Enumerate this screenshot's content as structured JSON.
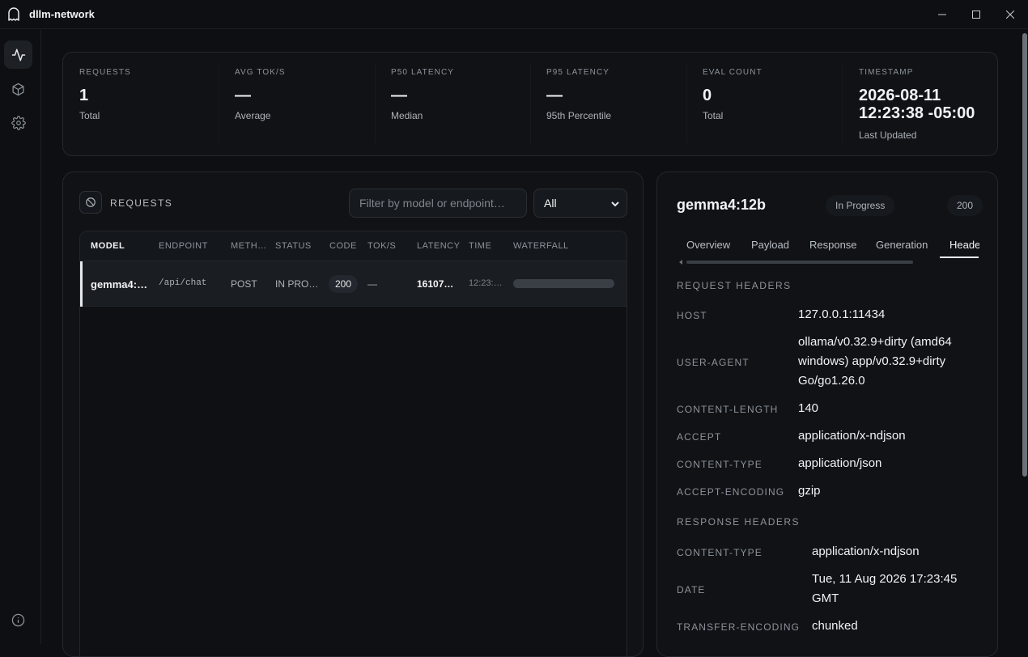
{
  "app": {
    "title": "dllm-network"
  },
  "stats": [
    {
      "label": "REQUESTS",
      "value": "1",
      "sub": "Total"
    },
    {
      "label": "AVG TOK/S",
      "value": "—",
      "sub": "Average"
    },
    {
      "label": "P50 LATENCY",
      "value": "—",
      "sub": "Median"
    },
    {
      "label": "P95 LATENCY",
      "value": "—",
      "sub": "95th Percentile"
    },
    {
      "label": "EVAL COUNT",
      "value": "0",
      "sub": "Total"
    },
    {
      "label": "TIMESTAMP",
      "value_line1": "2026-08-11",
      "value_line2": "12:23:38 -05:00",
      "sub": "Last Updated"
    }
  ],
  "requests": {
    "title": "REQUESTS",
    "filter_placeholder": "Filter by model or endpoint…",
    "select_value": "All",
    "columns": [
      "MODEL",
      "ENDPOINT",
      "METH…",
      "STATUS",
      "CODE",
      "TOK/S",
      "LATENCY",
      "TIME",
      "WATERFALL"
    ],
    "rows": [
      {
        "model": "gemma4:…",
        "endpoint": "/api/chat",
        "method": "POST",
        "status": "IN PRO…",
        "code": "200",
        "toks": "—",
        "latency": "16107…",
        "time": "12:23:…",
        "waterfall_fraction": 0.0
      }
    ]
  },
  "detail": {
    "model": "gemma4:12b",
    "status": "In Progress",
    "code": "200",
    "tabs": [
      "Overview",
      "Payload",
      "Response",
      "Generation",
      "Heade"
    ],
    "active_tab": "Heade",
    "request_headers_title": "REQUEST HEADERS",
    "request_headers": [
      {
        "key": "HOST",
        "value": "127.0.0.1:11434"
      },
      {
        "key": "USER-AGENT",
        "value": "ollama/v0.32.9+dirty (amd64 windows) app/v0.32.9+dirty Go/go1.26.0"
      },
      {
        "key": "CONTENT-LENGTH",
        "value": "140"
      },
      {
        "key": "ACCEPT",
        "value": "application/x-ndjson"
      },
      {
        "key": "CONTENT-TYPE",
        "value": "application/json"
      },
      {
        "key": "ACCEPT-ENCODING",
        "value": "gzip"
      }
    ],
    "response_headers_title": "RESPONSE HEADERS",
    "response_headers": [
      {
        "key": "CONTENT-TYPE",
        "value": "application/x-ndjson"
      },
      {
        "key": "DATE",
        "value": "Tue, 11 Aug 2026 17:23:45 GMT"
      },
      {
        "key": "TRANSFER-ENCODING",
        "value": "chunked"
      }
    ]
  },
  "icons": [
    "ghost-logo-icon",
    "minimize-icon",
    "maximize-icon",
    "close-icon",
    "activity-icon",
    "cube-icon",
    "gear-icon",
    "info-icon",
    "clear-icon",
    "chevron-down-icon"
  ]
}
